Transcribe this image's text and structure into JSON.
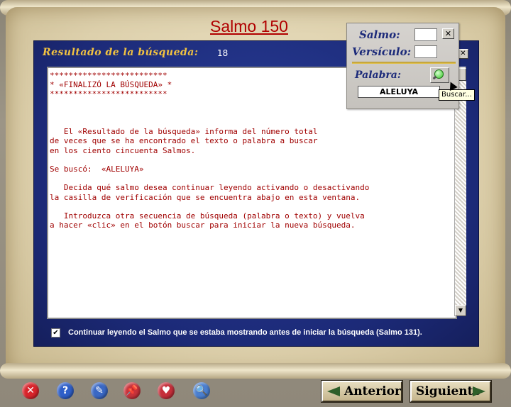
{
  "title": "Salmo 150",
  "results": {
    "label": "Resultado de la búsqueda:",
    "count": "18",
    "text": "*************************\n* «FINALIZÓ LA BÚSQUEDA» *\n*************************\n\n\n\n   El «Resultado de la búsqueda» informa del número total\nde veces que se ha encontrado el texto o palabra a buscar\nen los ciento cincuenta Salmos.\n\nSe buscó:  «ALELUYA»\n\n   Decida qué salmo desea continuar leyendo activando o desactivando\nla casilla de verificación que se encuentra abajo en esta ventana.\n\n   Introduzca otra secuencia de búsqueda (palabra o texto) y vuelva\na hacer «clic» en el botón buscar para iniciar la nueva búsqueda."
  },
  "continue_option": {
    "checked": true,
    "check_mark": "✔",
    "label": "Continuar leyendo el Salmo que se estaba mostrando antes de iniciar la búsqueda (Salmo 131)."
  },
  "search_panel": {
    "salmo_label": "Salmo:",
    "versiculo_label": "Versículo:",
    "palabra_label": "Palabra:",
    "salmo_value": "",
    "versiculo_value": "",
    "word_value": "ALELUYA",
    "close_glyph": "✕",
    "tooltip": "Buscar..."
  },
  "scroll": {
    "up": "▲",
    "down": "▼"
  },
  "toolbar": [
    {
      "name": "exit-icon",
      "glyph": "✕",
      "color": "#d8242b"
    },
    {
      "name": "help-icon",
      "glyph": "?",
      "color": "#2f5fc8"
    },
    {
      "name": "notes-icon",
      "glyph": "✎",
      "color": "#3a68c4"
    },
    {
      "name": "bookmark-icon",
      "glyph": "📌",
      "color": "#c8323a"
    },
    {
      "name": "favorites-icon",
      "glyph": "♥",
      "color": "#c62f3a"
    },
    {
      "name": "search-icon",
      "glyph": "🔍",
      "color": "#4a7fd0"
    }
  ],
  "nav": {
    "previous_label": "Anterior",
    "next_label": "Siguiente"
  }
}
